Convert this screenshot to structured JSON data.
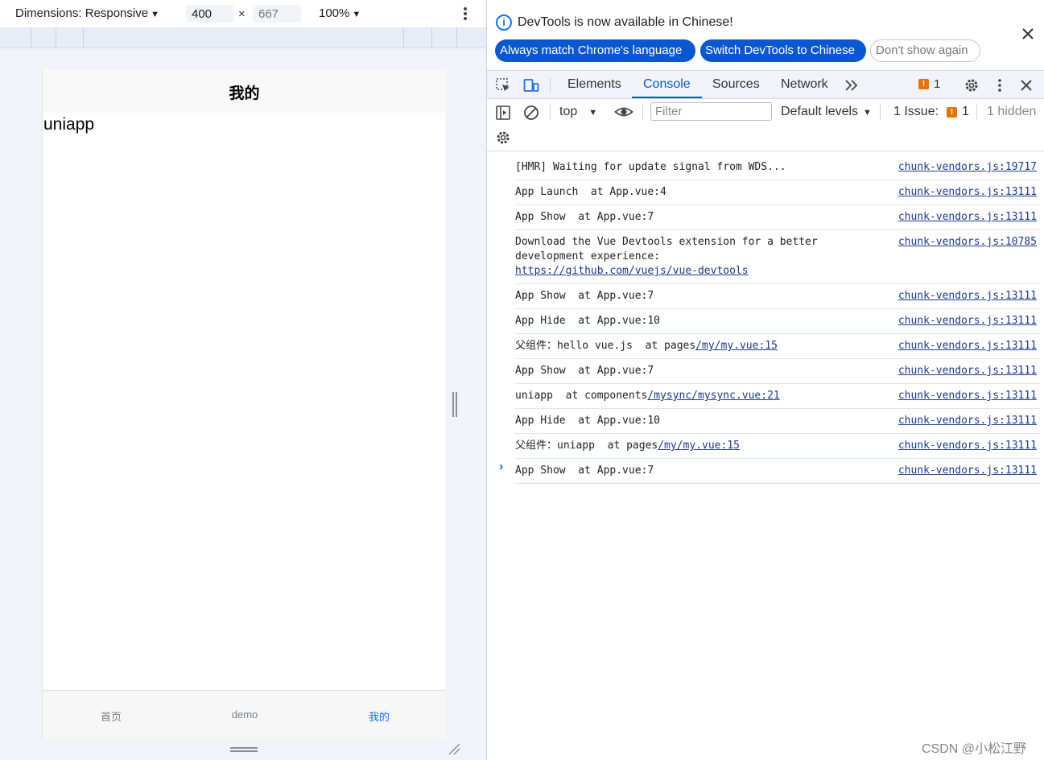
{
  "device_toolbar": {
    "dimensions_label": "Dimensions: Responsive",
    "width_value": "400",
    "height_value": "667",
    "times_sign": "×",
    "zoom": "100%"
  },
  "app": {
    "nav_title": "我的",
    "page_text": "uniapp",
    "tabs": [
      {
        "label": "首页"
      },
      {
        "label": "demo"
      },
      {
        "label": "我的"
      }
    ],
    "active_tab_color": "#007aff"
  },
  "infobar": {
    "message": "DevTools is now available in Chinese!",
    "buttons": {
      "match_language": "Always match Chrome's language",
      "switch_chinese": "Switch DevTools to Chinese",
      "dont_show": "Don't show again"
    }
  },
  "devtools_tabs": {
    "items": [
      "Elements",
      "Console",
      "Sources",
      "Network"
    ],
    "active": "Console",
    "issues_count": "1",
    "accent_color": "#0b57d0"
  },
  "console_toolbar": {
    "context": "top",
    "filter_placeholder": "Filter",
    "levels": "Default levels",
    "issues_label": "1 Issue:",
    "issues_count": "1",
    "hidden": "1 hidden"
  },
  "console_log": [
    {
      "message": "[HMR] Waiting for update signal from WDS...",
      "source": "chunk-vendors.js:19717"
    },
    {
      "message": "App Launch  at App.vue:4",
      "source": "chunk-vendors.js:13111"
    },
    {
      "message": "App Show  at App.vue:7",
      "source": "chunk-vendors.js:13111"
    },
    {
      "message": "Download the Vue Devtools extension for a better development experience:",
      "link": "https://github.com/vuejs/vue-devtools",
      "source": "chunk-vendors.js:10785"
    },
    {
      "message": "App Show  at App.vue:7",
      "source": "chunk-vendors.js:13111"
    },
    {
      "message": "App Hide  at App.vue:10",
      "source": "chunk-vendors.js:13111"
    },
    {
      "message": "父组件：hello vue.js  at pages",
      "link": "/my/my.vue:15",
      "source": "chunk-vendors.js:13111"
    },
    {
      "message": "App Show  at App.vue:7",
      "source": "chunk-vendors.js:13111"
    },
    {
      "message": "uniapp  at components",
      "link": "/mysync/mysync.vue:21",
      "source": "chunk-vendors.js:13111"
    },
    {
      "message": "App Hide  at App.vue:10",
      "source": "chunk-vendors.js:13111"
    },
    {
      "message": "父组件：uniapp  at pages",
      "link": "/my/my.vue:15",
      "source": "chunk-vendors.js:13111"
    },
    {
      "message": "App Show  at App.vue:7",
      "source": "chunk-vendors.js:13111"
    }
  ],
  "prompt_symbol": "›",
  "watermark": "CSDN @小松江野"
}
